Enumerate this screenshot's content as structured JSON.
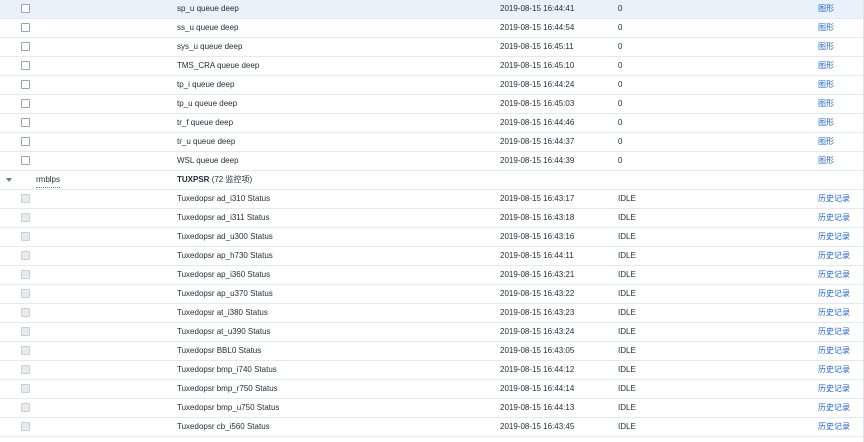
{
  "items_top": [
    {
      "name": "sp_u queue deep",
      "time": "2019-08-15 16:44:41",
      "value": "0",
      "action": "图形"
    },
    {
      "name": "ss_u queue deep",
      "time": "2019-08-15 16:44:54",
      "value": "0",
      "action": "图形"
    },
    {
      "name": "sys_u queue deep",
      "time": "2019-08-15 16:45:11",
      "value": "0",
      "action": "图形"
    },
    {
      "name": "TMS_CRA queue deep",
      "time": "2019-08-15 16:45:10",
      "value": "0",
      "action": "图形"
    },
    {
      "name": "tp_i queue deep",
      "time": "2019-08-15 16:44:24",
      "value": "0",
      "action": "图形"
    },
    {
      "name": "tp_u queue deep",
      "time": "2019-08-15 16:45:03",
      "value": "0",
      "action": "图形"
    },
    {
      "name": "tr_f queue deep",
      "time": "2019-08-15 16:44:46",
      "value": "0",
      "action": "图形"
    },
    {
      "name": "tr_u queue deep",
      "time": "2019-08-15 16:44:37",
      "value": "0",
      "action": "图形"
    },
    {
      "name": "WSL queue deep",
      "time": "2019-08-15 16:44:39",
      "value": "0",
      "action": "图形"
    }
  ],
  "group": {
    "host": "rmblps",
    "title": "TUXPSR",
    "count": "(72 监控项)"
  },
  "items_group": [
    {
      "name": "Tuxedopsr ad_i310 Status",
      "time": "2019-08-15 16:43:17",
      "value": "IDLE",
      "action": "历史记录"
    },
    {
      "name": "Tuxedopsr ad_i311 Status",
      "time": "2019-08-15 16:43:18",
      "value": "IDLE",
      "action": "历史记录"
    },
    {
      "name": "Tuxedopsr ad_u300 Status",
      "time": "2019-08-15 16:43:16",
      "value": "IDLE",
      "action": "历史记录"
    },
    {
      "name": "Tuxedopsr ap_h730 Status",
      "time": "2019-08-15 16:44:11",
      "value": "IDLE",
      "action": "历史记录"
    },
    {
      "name": "Tuxedopsr ap_i360 Status",
      "time": "2019-08-15 16:43:21",
      "value": "IDLE",
      "action": "历史记录"
    },
    {
      "name": "Tuxedopsr ap_u370 Status",
      "time": "2019-08-15 16:43:22",
      "value": "IDLE",
      "action": "历史记录"
    },
    {
      "name": "Tuxedopsr at_i380 Status",
      "time": "2019-08-15 16:43:23",
      "value": "IDLE",
      "action": "历史记录"
    },
    {
      "name": "Tuxedopsr at_u390 Status",
      "time": "2019-08-15 16:43:24",
      "value": "IDLE",
      "action": "历史记录"
    },
    {
      "name": "Tuxedopsr BBL0 Status",
      "time": "2019-08-15 16:43:05",
      "value": "IDLE",
      "action": "历史记录"
    },
    {
      "name": "Tuxedopsr bmp_i740 Status",
      "time": "2019-08-15 16:44:12",
      "value": "IDLE",
      "action": "历史记录"
    },
    {
      "name": "Tuxedopsr bmp_r750 Status",
      "time": "2019-08-15 16:44:14",
      "value": "IDLE",
      "action": "历史记录"
    },
    {
      "name": "Tuxedopsr bmp_u750 Status",
      "time": "2019-08-15 16:44:13",
      "value": "IDLE",
      "action": "历史记录"
    },
    {
      "name": "Tuxedopsr cb_i560 Status",
      "time": "2019-08-15 16:43:45",
      "value": "IDLE",
      "action": "历史记录"
    }
  ]
}
